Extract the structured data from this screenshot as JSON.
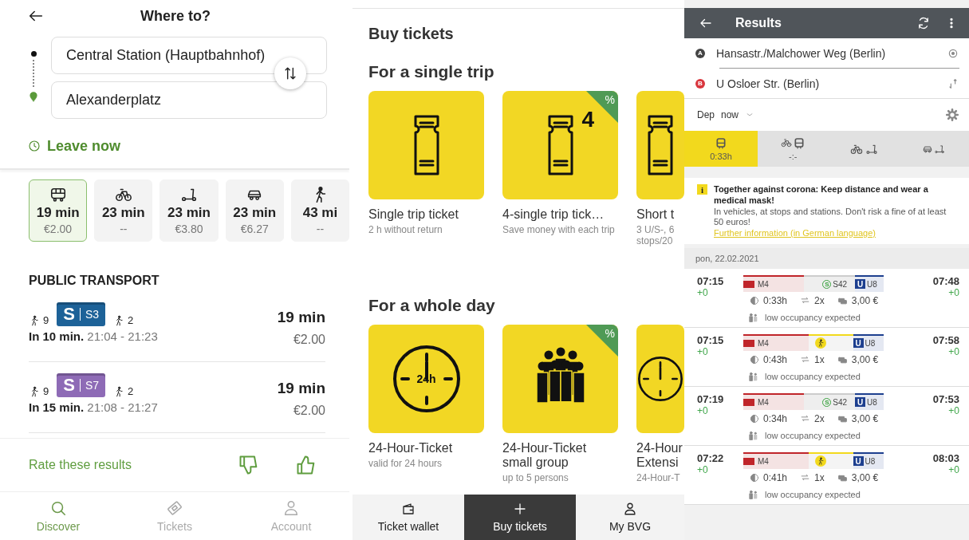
{
  "discover": {
    "header": {
      "title": "Where to?"
    },
    "from": {
      "value": "Central Station (Hauptbahnhof)"
    },
    "to": {
      "value": "Alexanderplatz"
    },
    "leave": "Leave now",
    "modes": [
      {
        "kind": "bus",
        "time": "19 min",
        "price": "€2.00",
        "selected": true
      },
      {
        "kind": "bike",
        "time": "23 min",
        "price": "--",
        "selected": false
      },
      {
        "kind": "scooter",
        "time": "23 min",
        "price": "€3.80",
        "selected": false
      },
      {
        "kind": "car",
        "time": "23 min",
        "price": "€6.27",
        "selected": false
      },
      {
        "kind": "walk",
        "time": "43 mi",
        "price": "--",
        "selected": false
      }
    ],
    "section": "PUBLIC TRANSPORT",
    "routes": [
      {
        "walk_before": "9",
        "product": "S",
        "line": "S3",
        "color": "#1d6298",
        "walk_after": "2",
        "duration": "19 min",
        "price": "€2.00",
        "when": "**In 10 min.** 21:04 - 21:23"
      },
      {
        "walk_before": "9",
        "product": "S",
        "line": "S7",
        "color": "#8e6bb6",
        "walk_after": "2",
        "duration": "19 min",
        "price": "€2.00",
        "when": "**In 15 min.** 21:08 - 21:27"
      }
    ],
    "rate": "Rate these results",
    "nav": [
      {
        "kind": "search",
        "label": "Discover",
        "selected": true
      },
      {
        "kind": "ticket",
        "label": "Tickets",
        "selected": false
      },
      {
        "kind": "person",
        "label": "Account",
        "selected": false
      }
    ]
  },
  "tickets": {
    "title": "Buy tickets",
    "sections": [
      {
        "title": "For a single trip",
        "items": [
          {
            "kind": "ticket",
            "title": "Single trip ticket",
            "subtitle": "2 h without return"
          },
          {
            "kind": "ticket",
            "title": "4-single trip tick…",
            "subtitle": "Save money with each trip",
            "count": "4",
            "discount": "%"
          },
          {
            "kind": "ticket",
            "title": "Short t",
            "subtitle": "3 U/S-, 6 stops/20"
          }
        ]
      },
      {
        "title": "For a whole day",
        "items": [
          {
            "kind": "clock",
            "title": "24-Hour-Ticket",
            "subtitle": "valid for 24 hours",
            "count": "24h"
          },
          {
            "kind": "group",
            "title": "24-Hour-Ticket small group",
            "subtitle": "up to 5 persons",
            "discount": "%"
          },
          {
            "kind": "clock",
            "title": "24-Hour Extensi",
            "subtitle": "24-Hour-T"
          }
        ]
      }
    ],
    "nav": [
      {
        "kind": "wallet",
        "label": "Ticket wallet",
        "selected": false
      },
      {
        "kind": "plus",
        "label": "Buy tickets",
        "selected": true
      },
      {
        "kind": "person",
        "label": "My BVG",
        "selected": false
      }
    ]
  },
  "results": {
    "title": "Results",
    "from": {
      "marker": "A",
      "value": "Hansastr./Malchower Weg (Berlin)"
    },
    "to": {
      "marker": "B",
      "value": "U Osloer Str. (Berlin)"
    },
    "dep_label": "Dep",
    "dep_value": "now",
    "modes": [
      {
        "kind": "transit",
        "label": "0:33h",
        "selected": true
      },
      {
        "kind": "bike_transit",
        "label": "-:-",
        "selected": false
      },
      {
        "kind": "bike_scooter",
        "selected": false
      },
      {
        "kind": "car_scooter",
        "selected": false
      }
    ],
    "notice": {
      "icon": "i",
      "title": "Together against corona: Keep distance and wear a medical mask!",
      "body": "In vehicles, at stops and stations. Don't risk a fine of at least 50 euros!",
      "link": "Further information (in German language)"
    },
    "date": "pon, 22.02.2021",
    "trips": [
      {
        "dep": "07:15",
        "dep_delay": "+0",
        "arr": "07:48",
        "arr_delay": "+0",
        "legs": [
          {
            "kind": "tram",
            "line": "M4"
          },
          {
            "kind": "sbahn",
            "symbol": "S",
            "line": "S42"
          },
          {
            "kind": "ubahn",
            "symbol": "U",
            "line": "U8"
          }
        ],
        "duration": "0:33h",
        "changes": "2x",
        "price": "3,00 €",
        "occupancy": "low occupancy expected"
      },
      {
        "dep": "07:15",
        "dep_delay": "+0",
        "arr": "07:58",
        "arr_delay": "+0",
        "legs": [
          {
            "kind": "tram",
            "line": "M4"
          },
          {
            "kind": "walk"
          },
          {
            "kind": "ubahn",
            "symbol": "U",
            "line": "U8"
          }
        ],
        "duration": "0:43h",
        "changes": "1x",
        "price": "3,00 €",
        "occupancy": "low occupancy expected"
      },
      {
        "dep": "07:19",
        "dep_delay": "+0",
        "arr": "07:53",
        "arr_delay": "+0",
        "legs": [
          {
            "kind": "tram",
            "line": "M4"
          },
          {
            "kind": "sbahn",
            "symbol": "S",
            "line": "S42"
          },
          {
            "kind": "ubahn",
            "symbol": "U",
            "line": "U8"
          }
        ],
        "duration": "0:34h",
        "changes": "2x",
        "price": "3,00 €",
        "occupancy": "low occupancy expected"
      },
      {
        "dep": "07:22",
        "dep_delay": "+0",
        "arr": "08:03",
        "arr_delay": "+0",
        "legs": [
          {
            "kind": "tram",
            "line": "M4"
          },
          {
            "kind": "walk"
          },
          {
            "kind": "ubahn",
            "symbol": "U",
            "line": "U8"
          }
        ],
        "duration": "0:41h",
        "changes": "1x",
        "price": "3,00 €",
        "occupancy": "low occupancy expected"
      }
    ]
  }
}
